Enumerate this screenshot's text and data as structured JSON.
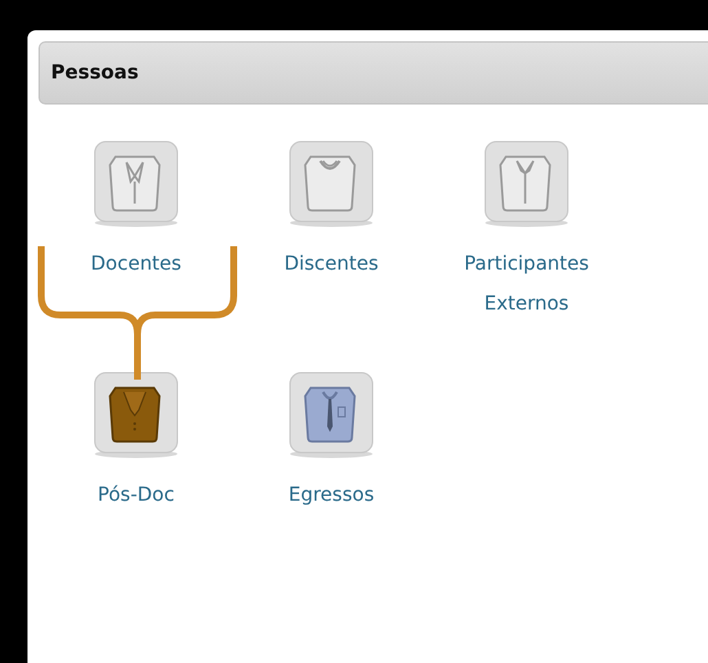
{
  "panel": {
    "title": "Pessoas"
  },
  "items": [
    {
      "label": "Docentes",
      "kind": "blazer"
    },
    {
      "label": "Discentes",
      "kind": "tshirt"
    },
    {
      "label": "Participantes Externos",
      "kind": "shirt"
    },
    {
      "label": "Pós-Doc",
      "kind": "suit"
    },
    {
      "label": "Egressos",
      "kind": "tie"
    }
  ]
}
